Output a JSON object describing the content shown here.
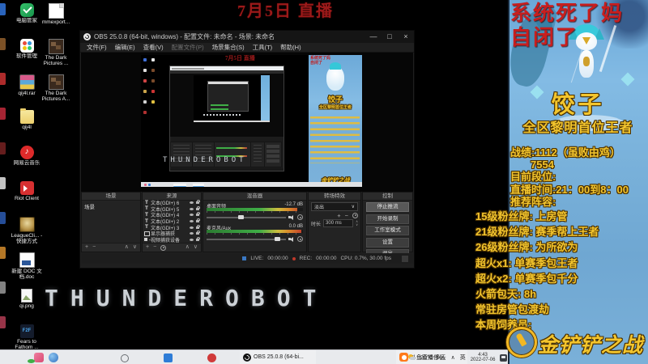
{
  "desktop": {
    "wallpaper_text": "THUNDEROBOT",
    "top_title": "7月5日 直播",
    "icons_col1": [
      {
        "label": "电脑管家",
        "kind": "pcmgr"
      },
      {
        "label": "软件管理",
        "kind": "softmgr"
      },
      {
        "label": "qij4l.rar",
        "kind": "rar"
      },
      {
        "label": "qij4l",
        "kind": "folder"
      },
      {
        "label": "网易云音乐",
        "kind": "netease"
      },
      {
        "label": "Riot Client",
        "kind": "riot"
      },
      {
        "label": "LeagueCli... - 快捷方式",
        "kind": "league"
      },
      {
        "label": "新建 DOC 文档.doc",
        "kind": "doc"
      },
      {
        "label": "qi.png",
        "kind": "png"
      },
      {
        "label": "Fears to Fathom ...",
        "kind": "f2f",
        "icon_text": "F2F"
      }
    ],
    "icons_col2": [
      {
        "label": "mmexport...",
        "kind": "image"
      },
      {
        "label": "The Dark Pictures ...",
        "kind": "photo"
      },
      {
        "label": "The Dark Pictures A...",
        "kind": "photo"
      }
    ],
    "edge_icons": [
      "#2f6fd0",
      "#8a5a2a",
      "#c03030",
      "#b82838",
      "#702020",
      "#d8d8d8",
      "#2a56a8",
      "#c8842a",
      "#909090",
      "#a83a50"
    ]
  },
  "obs": {
    "title": "OBS 25.0.8 (64-bit, windows) - 配置文件: 未命名 - 场景: 未命名",
    "menus": [
      "文件(F)",
      "编辑(E)",
      "查看(V)",
      "配置文件(P)",
      "场景集合(S)",
      "工具(T)",
      "帮助(H)"
    ],
    "scenes": {
      "title": "场景",
      "items": [
        "场景"
      ]
    },
    "sources": {
      "title": "来源",
      "items": [
        {
          "label": "文本(GDI+) 6",
          "type": "text"
        },
        {
          "label": "文本(GDI+) 5",
          "type": "text"
        },
        {
          "label": "文本(GDI+) 4",
          "type": "text"
        },
        {
          "label": "文本(GDI+) 2",
          "type": "text"
        },
        {
          "label": "文本(GDI+) 3",
          "type": "text"
        },
        {
          "label": "显示器捕获",
          "type": "monitor"
        },
        {
          "label": "视频捕获设备",
          "type": "camera"
        }
      ]
    },
    "mixer": {
      "title": "混音器",
      "channels": [
        {
          "name": "桌面音频",
          "db": "-12.7 dB"
        },
        {
          "name": "麦克风/Aux",
          "db": "0.0 dB"
        }
      ]
    },
    "transitions": {
      "title": "转场特效",
      "selected": "淡出",
      "duration_label": "时长",
      "duration": "300 ms"
    },
    "controls": {
      "title": "控制",
      "buttons": [
        "停止推流",
        "开始录制",
        "工作室模式",
        "设置",
        "退出"
      ]
    },
    "statusbar": {
      "live_label": "LIVE:",
      "live_time": "00:00:00",
      "rec_label": "REC:",
      "rec_time": "00:00:00",
      "cpu": "CPU: 0.7%, 30.00 fps"
    }
  },
  "overlay": {
    "warn_line1": "系统死了妈",
    "warn_line2": "自闭了",
    "streamer": "饺子",
    "subtitle": "全区黎明首位王者",
    "info_lines": [
      {
        "text": "战绩:1112（虽败由鸡）",
        "ind": "a"
      },
      {
        "text": "7554",
        "ind": "b"
      },
      {
        "text": "目前段位:",
        "ind": "a"
      },
      {
        "text": "直播时间:21：00到8：00",
        "ind": "a"
      },
      {
        "text": "推荐阵容:",
        "ind": "a"
      }
    ],
    "perk_lines": [
      {
        "text": "15级粉丝牌: 上房管",
        "ind": "c"
      },
      {
        "text": "21级粉丝牌: 赛季帮上王者",
        "ind": "c"
      },
      {
        "text": "26级粉丝牌: 为所欲为",
        "ind": "c"
      },
      {
        "text": "超火x1: 单赛季包王者",
        "ind": "c"
      },
      {
        "text": "超火x2: 单赛季包千分",
        "ind": "c"
      },
      {
        "text": "火箭包天: 8h",
        "ind": "c"
      },
      {
        "text": "常驻房管包渡劫",
        "ind": "c"
      },
      {
        "text": "本周饲养员:",
        "ind": "c"
      }
    ],
    "logo": "金铲铲之战"
  },
  "taskbar": {
    "obs_task": "OBS 25.0.8 (64-bi...",
    "douyu_task": "斗鱼直播伴侣",
    "weather": "20°C 多云",
    "tray_expand": "∧",
    "lang": "英",
    "time": "4:43",
    "date": "2022-07-06"
  },
  "glyphs": {
    "plus": "+",
    "minus": "−",
    "up": "∧",
    "down": "∨",
    "caret": "∨",
    "min": "—",
    "max": "□",
    "close": "×"
  },
  "colors": {
    "accent_blue": "#56a0e0",
    "gold": "#f3c52d",
    "title_red": "#9c1a1a",
    "overlay_red": "#c81e1e",
    "meter_green": "#3fae46"
  }
}
